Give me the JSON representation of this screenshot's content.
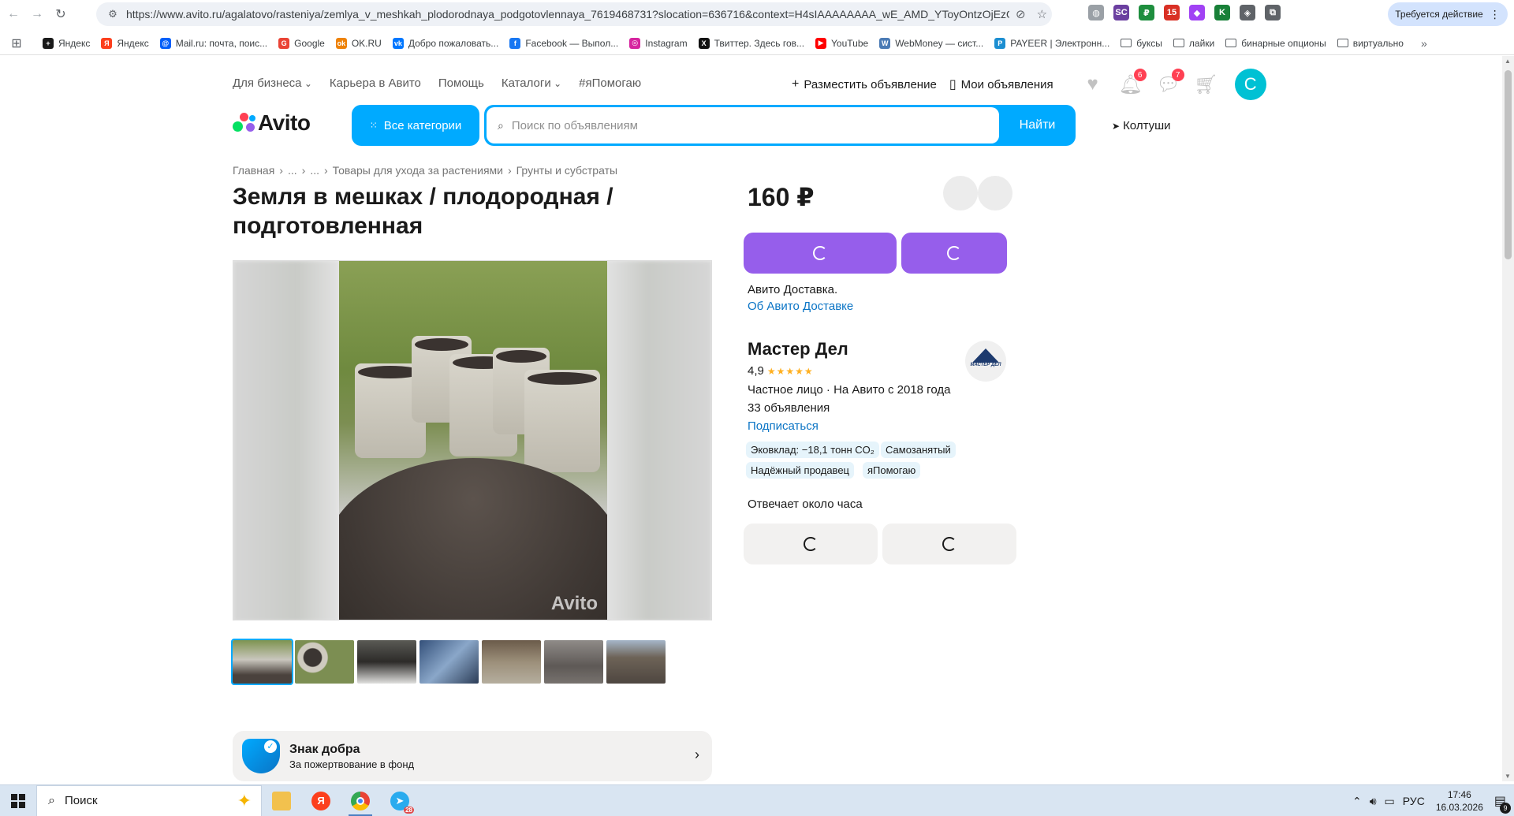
{
  "browser": {
    "url": "https://www.avito.ru/agalatovo/rasteniya/zemlya_v_meshkah_plodorodnaya_podgotovlennaya_7619468731?slocation=636716&context=H4sIAAAAAAAA_wE_AMD_YToyOntzOjEzOiJs...",
    "action_pill": "Требуется действие",
    "extensions": [
      {
        "icon": "globe-icon",
        "label": "◍",
        "color": "#9aa0a6"
      },
      {
        "icon": "sc-extension-icon",
        "label": "SC",
        "color": "#6b3fa0"
      },
      {
        "icon": "ruble-extension-icon",
        "label": "₽",
        "color": "#1e8e3e"
      },
      {
        "icon": "calendar-extension-icon",
        "label": "15",
        "color": "#d93025"
      },
      {
        "icon": "gem-extension-icon",
        "label": "◆",
        "color": "#a142f4"
      },
      {
        "icon": "ok-extension-icon",
        "label": "K",
        "color": "#188038"
      },
      {
        "icon": "shield-extension-icon",
        "label": "◈",
        "color": "#5f6368"
      },
      {
        "icon": "puzzle-icon",
        "label": "⧉",
        "color": "#5f6368"
      }
    ]
  },
  "bookmarks": [
    {
      "label": "Яндекс",
      "fav": "+",
      "color": "#1a1a1a",
      "type": "site"
    },
    {
      "label": "Яндекс",
      "fav": "Я",
      "color": "#fc3f1d",
      "type": "site"
    },
    {
      "label": "Mail.ru: почта, поис...",
      "fav": "@",
      "color": "#005ff9",
      "type": "site"
    },
    {
      "label": "Google",
      "fav": "G",
      "color": "#ea4335",
      "type": "site"
    },
    {
      "label": "OK.RU",
      "fav": "ok",
      "color": "#ee8208",
      "type": "site"
    },
    {
      "label": "Добро пожаловать...",
      "fav": "vk",
      "color": "#0077ff",
      "type": "site"
    },
    {
      "label": "Facebook — Выпол...",
      "fav": "f",
      "color": "#1877f2",
      "type": "site"
    },
    {
      "label": "Instagram",
      "fav": "◎",
      "color": "#d6249f",
      "type": "site"
    },
    {
      "label": "Твиттер. Здесь гов...",
      "fav": "X",
      "color": "#111111",
      "type": "site"
    },
    {
      "label": "YouTube",
      "fav": "▶",
      "color": "#ff0000",
      "type": "site"
    },
    {
      "label": "WebMoney — сист...",
      "fav": "W",
      "color": "#4b7bb5",
      "type": "site"
    },
    {
      "label": "PAYEER | Электронн...",
      "fav": "P",
      "color": "#1c8ed1",
      "type": "site"
    },
    {
      "label": "буксы",
      "type": "folder"
    },
    {
      "label": "лайки",
      "type": "folder"
    },
    {
      "label": "бинарные опционы",
      "type": "folder"
    },
    {
      "label": "виртуально",
      "type": "folder"
    }
  ],
  "header": {
    "nav": [
      "Для бизнеса",
      "Карьера в Авито",
      "Помощь",
      "Каталоги",
      "#яПомогаю"
    ],
    "post_ad": "Разместить объявление",
    "my_ads": "Мои объявления",
    "notifications_count": "6",
    "messages_count": "7",
    "avatar_letter": "С",
    "logo_text": "Avito",
    "all_categories": "Все категории",
    "search_placeholder": "Поиск по объявлениям",
    "search_button": "Найти",
    "location": "Колтуши"
  },
  "breadcrumbs": [
    "Главная",
    "...",
    "...",
    "Товары для ухода за растениями",
    "Грунты и субстраты"
  ],
  "listing": {
    "title": "Земля в мешках / плодородная / подготовленная",
    "price": "160 ₽",
    "photo_count": 7,
    "watermark": "Avito",
    "delivery_text": "Авито Доставка.",
    "delivery_link": "Об Авито Доставке"
  },
  "seller": {
    "name": "Мастер Дел",
    "avatar_text": "МАСТЕР ДЕЛ",
    "rating": "4,9",
    "stars": "★★★★★",
    "type_line": "Частное лицо · На Авито с 2018 года",
    "ads_count": "33 объявления",
    "subscribe": "Подписаться",
    "tags": [
      "Эковклад: −18,1 тонн CO₂",
      "Самозанятый",
      "Надёжный продавец",
      "яПомогаю"
    ],
    "response_time": "Отвечает около часа"
  },
  "charity": {
    "title": "Знак добра",
    "subtitle": "За пожертвование в фонд"
  },
  "taskbar": {
    "search_placeholder": "Поиск",
    "language": "РУС",
    "time": "17:46",
    "date": "16.03.2026",
    "telegram_count": "28",
    "notification_count": "9"
  }
}
